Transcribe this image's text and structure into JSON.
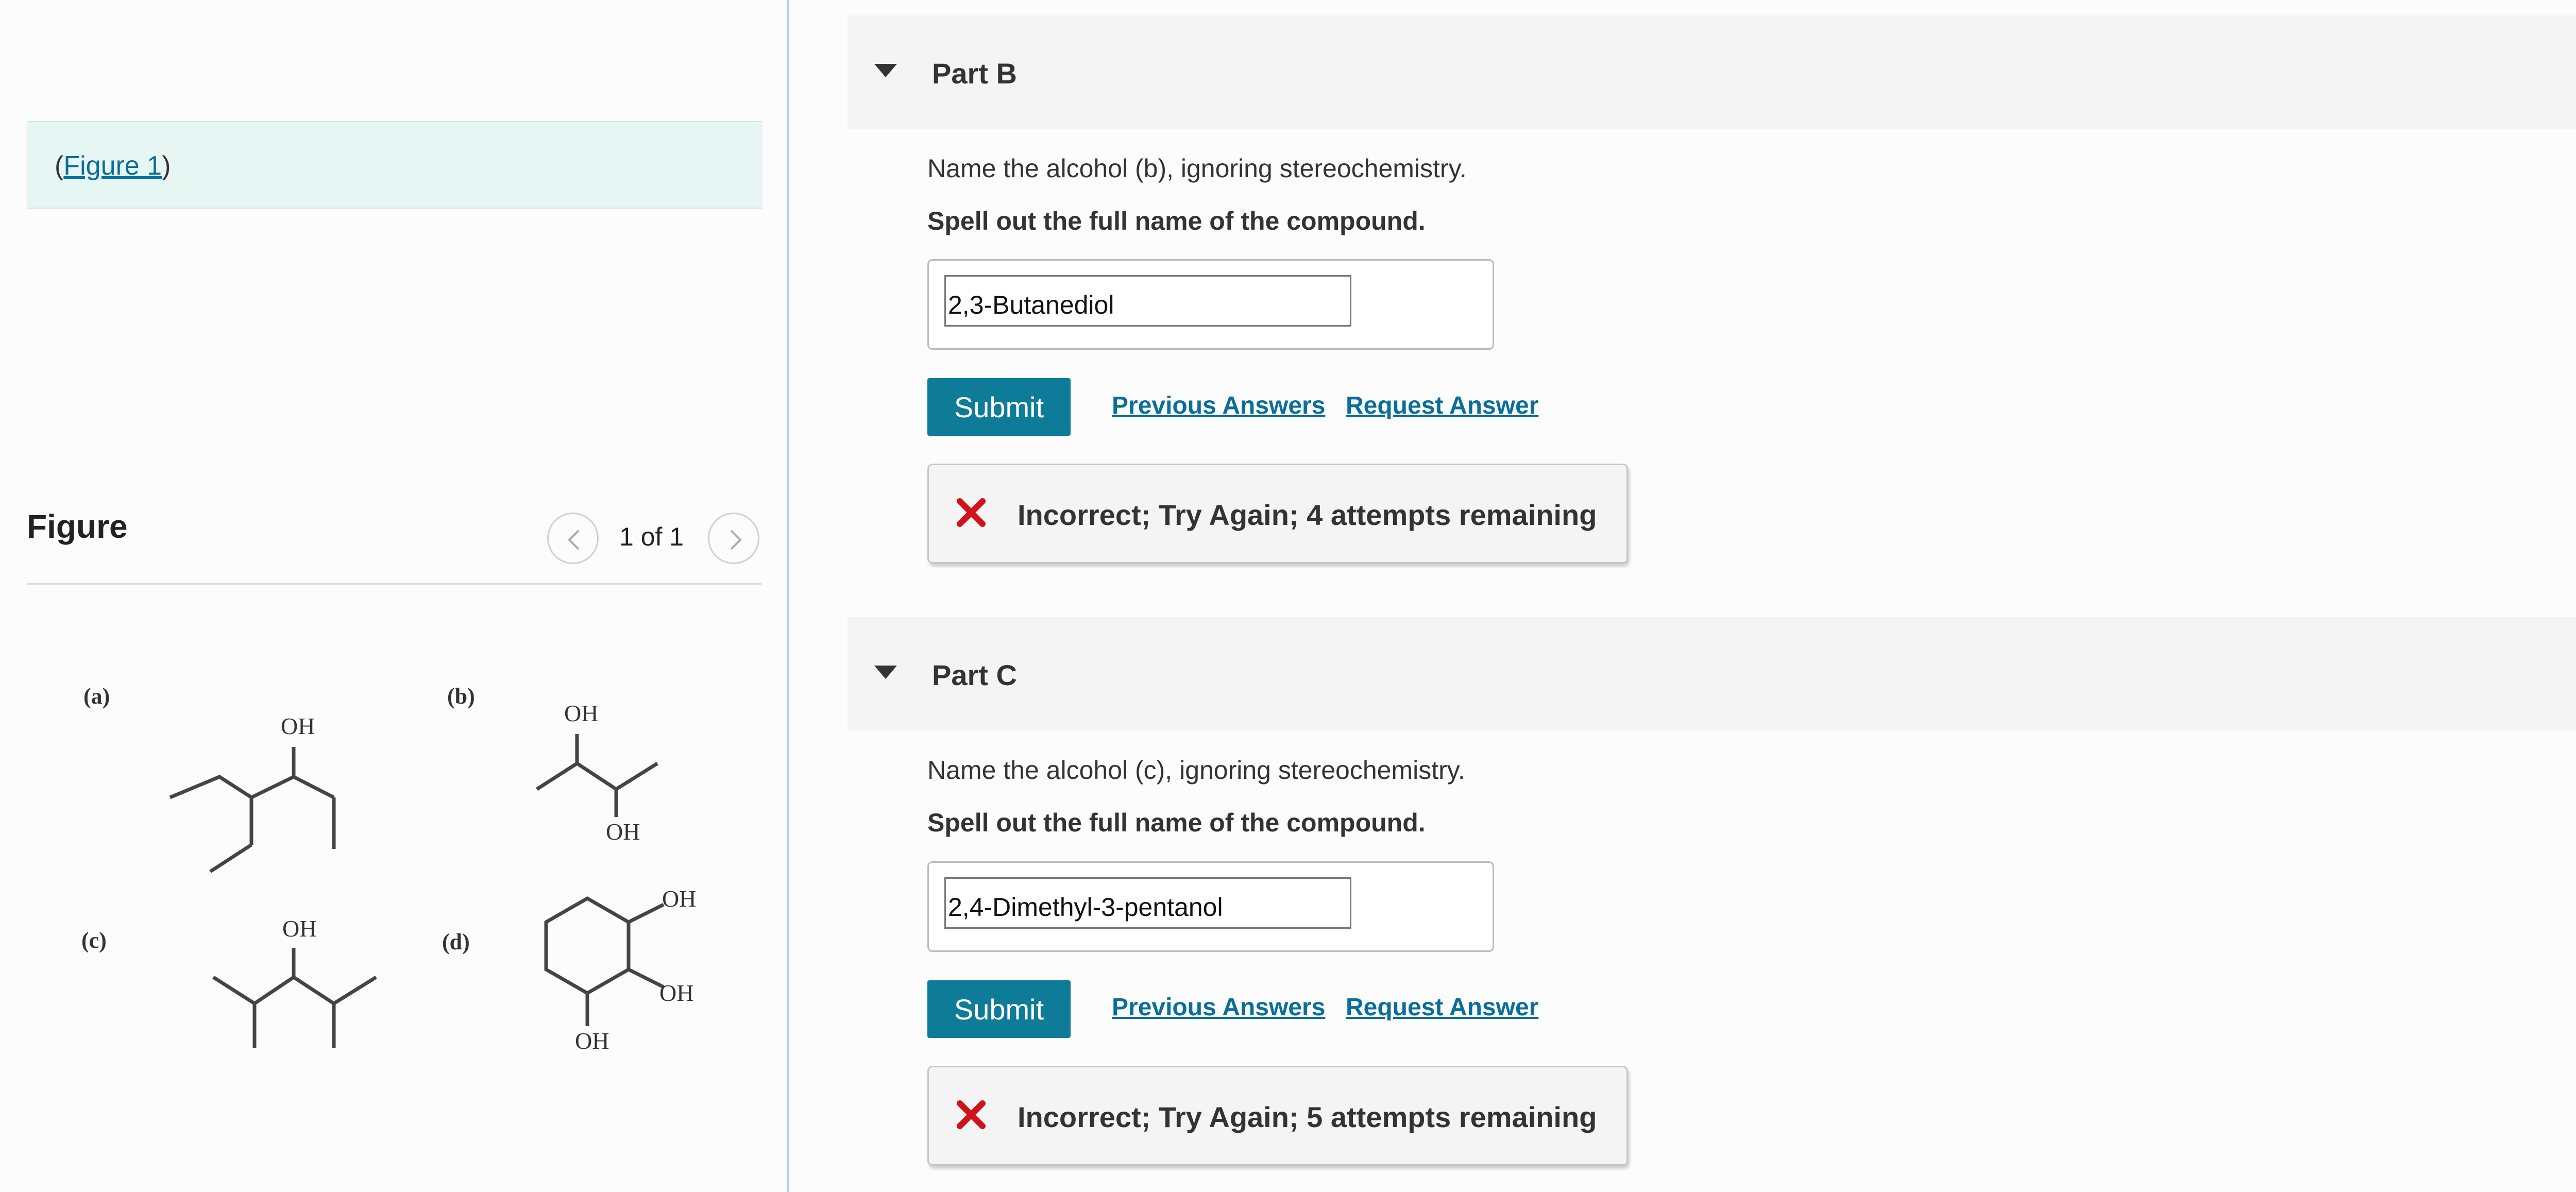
{
  "figure_panel": {
    "callout_open": "(",
    "callout_link": "Figure 1",
    "callout_close": ")",
    "title": "Figure",
    "pager_count": "1 of 1",
    "prev_icon": "chevron-left-icon",
    "next_icon": "chevron-right-icon",
    "molecule_labels": [
      "(a)",
      "(b)",
      "(c)",
      "(d)"
    ],
    "oh_label": "OH"
  },
  "parts": [
    {
      "title": "Part B",
      "question": "Name the alcohol (b), ignoring stereochemistry.",
      "instruction": "Spell out the full name of the compound.",
      "answer_value": "2,3-Butanediol",
      "submit_label": "Submit",
      "previous_answers_label": "Previous Answers",
      "request_answer_label": "Request Answer",
      "feedback": "Incorrect; Try Again; 4 attempts remaining"
    },
    {
      "title": "Part C",
      "question": "Name the alcohol (c), ignoring stereochemistry.",
      "instruction": "Spell out the full name of the compound.",
      "answer_value": "2,4-Dimethyl-3-pentanol",
      "submit_label": "Submit",
      "previous_answers_label": "Previous Answers",
      "request_answer_label": "Request Answer",
      "feedback": "Incorrect; Try Again; 5 attempts remaining"
    }
  ],
  "colors": {
    "accent": "#0e7b99",
    "link": "#0a6e9a",
    "error": "#d0121b",
    "callout_bg": "#e6f7f3"
  }
}
